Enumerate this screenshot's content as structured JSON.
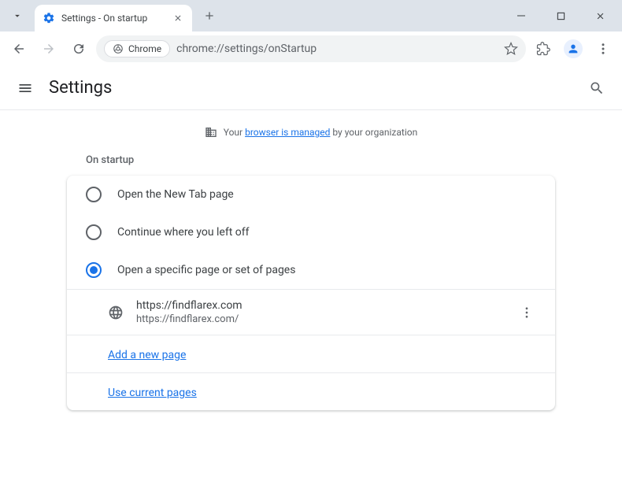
{
  "window": {
    "tab_title": "Settings - On startup"
  },
  "omnibox": {
    "chip_label": "Chrome",
    "url": "chrome://settings/onStartup"
  },
  "settings_header": {
    "title": "Settings"
  },
  "managed_banner": {
    "prefix": "Your ",
    "link": "browser is managed",
    "suffix": " by your organization"
  },
  "section": {
    "title": "On startup",
    "options": [
      {
        "label": "Open the New Tab page",
        "selected": false
      },
      {
        "label": "Continue where you left off",
        "selected": false
      },
      {
        "label": "Open a specific page or set of pages",
        "selected": true
      }
    ],
    "pages": [
      {
        "title": "https://findflarex.com",
        "url": "https://findflarex.com/"
      }
    ],
    "add_link": "Add a new page",
    "use_current_link": "Use current pages"
  }
}
